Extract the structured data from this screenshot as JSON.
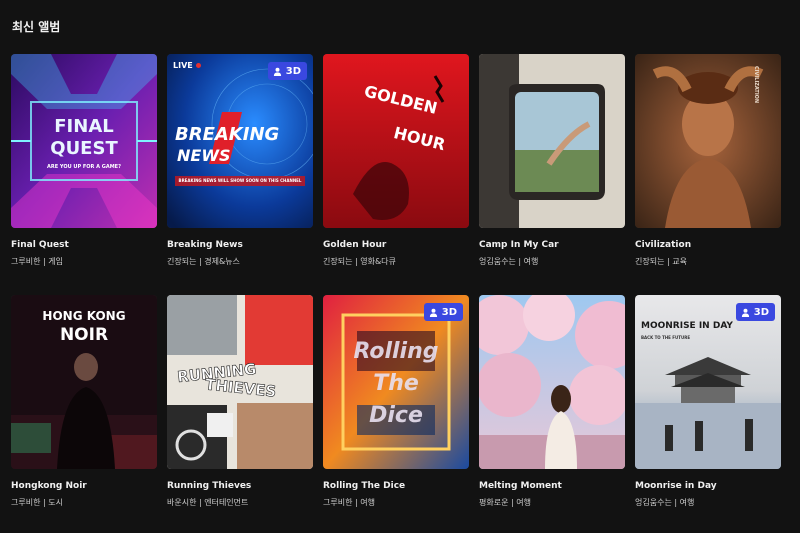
{
  "section": {
    "title": "최신 앨범"
  },
  "badges": {
    "three_d": "3D",
    "live": "LIVE"
  },
  "albums": [
    {
      "title": "Final Quest",
      "meta": "그루비한 | 게임",
      "art_line1": "FINAL",
      "art_line2": "QUEST",
      "art_sub": "ARE YOU UP FOR A GAME?",
      "is3d": false
    },
    {
      "title": "Breaking News",
      "meta": "긴장되는 | 경제&뉴스",
      "art_line1": "BREAKING",
      "art_line2": "NEWS",
      "art_sub": "BREAKING NEWS WILL SHOW SOON ON THIS CHANNEL",
      "is3d": true
    },
    {
      "title": "Golden Hour",
      "meta": "긴장되는 | 영화&다큐",
      "art_line1": "GOLDEN",
      "art_line2": "HOUR",
      "art_sub": "",
      "is3d": false
    },
    {
      "title": "Camp In My Car",
      "meta": "엉김움수는 | 여행",
      "art_line1": "",
      "art_line2": "",
      "art_sub": "",
      "is3d": false
    },
    {
      "title": "Civilization",
      "meta": "긴장되는 | 교육",
      "art_line1": "",
      "art_line2": "",
      "art_sub": "CIVILIZATION",
      "is3d": false
    },
    {
      "title": "Hongkong Noir",
      "meta": "그루비한 | 도시",
      "art_line1": "HONG KONG",
      "art_line2": "NOIR",
      "art_sub": "",
      "is3d": false
    },
    {
      "title": "Running Thieves",
      "meta": "바운시한 | 엔터테인먼트",
      "art_line1": "RUNNING",
      "art_line2": "THIEVES",
      "art_sub": "",
      "is3d": false
    },
    {
      "title": "Rolling The Dice",
      "meta": "그루비한 | 여행",
      "art_line1": "Rolling",
      "art_line2": "The",
      "art_line3": "Dice",
      "art_sub": "",
      "is3d": true
    },
    {
      "title": "Melting Moment",
      "meta": "평화로운 | 여행",
      "art_line1": "",
      "art_line2": "",
      "art_sub": "",
      "is3d": false
    },
    {
      "title": "Moonrise in Day",
      "meta": "엉김움수는 | 여행",
      "art_line1": "MOONRISE IN DAY",
      "art_line2": "",
      "art_sub": "BACK TO THE FUTURE",
      "is3d": true
    }
  ]
}
